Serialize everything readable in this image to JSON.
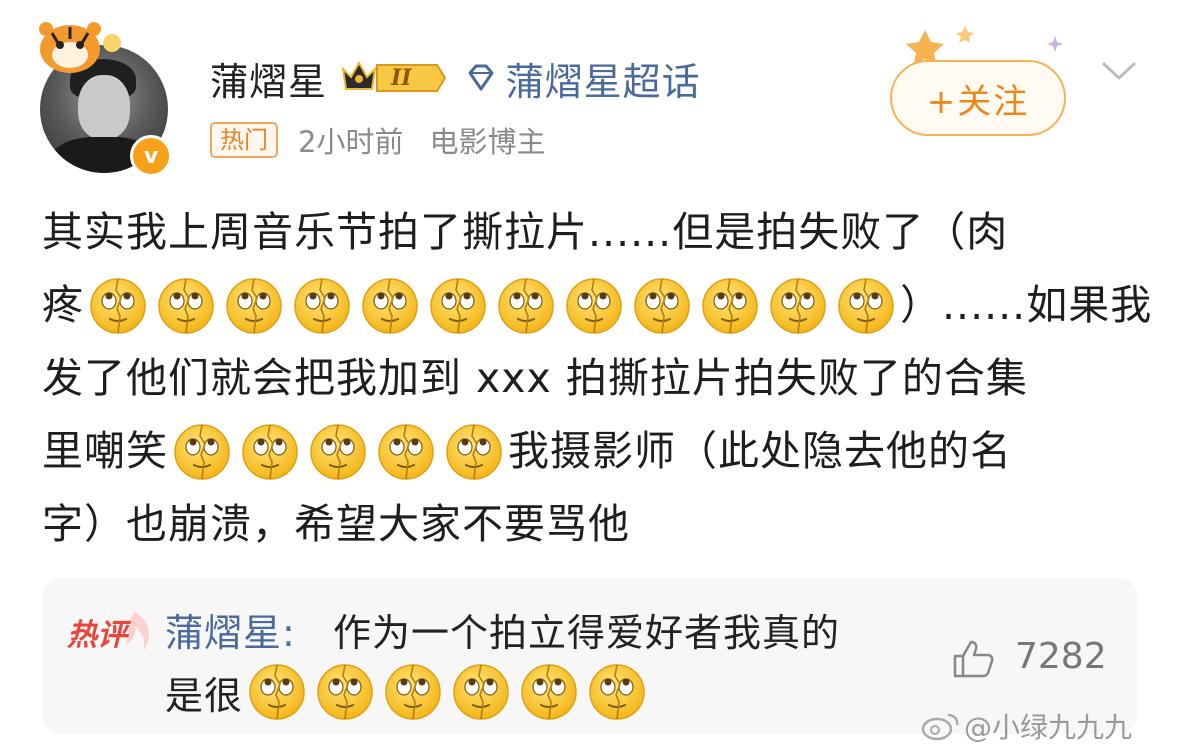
{
  "post": {
    "author": "蒲熠星",
    "vip_level": "II",
    "supertopic_label": "蒲熠星超话",
    "hot_tag": "热门",
    "time": "2小时前",
    "role": "电影博主",
    "follow_label": "+关注",
    "body": {
      "line1": "其实我上周音乐节拍了撕拉片......但是拍失败了（肉",
      "line2_prefix": "疼",
      "line2_suffix": "）......如果我",
      "line3": "发了他们就会把我加到 xxx 拍撕拉片拍失败了的合集",
      "line4_prefix": "里嘲笑",
      "line4_suffix": "我摄影师（此处隐去他的名",
      "line5": "字）也崩溃，希望大家不要骂他"
    },
    "emoji_name": "rolling-eyes-emoji"
  },
  "hot_comment": {
    "label": "热评",
    "author": "蒲熠星",
    "colon": ":",
    "line1": "作为一个拍立得爱好者我真的",
    "line2": "是很",
    "likes": "7282"
  },
  "watermark": {
    "text": "@小绿九九九"
  },
  "colors": {
    "accent_orange": "#f08619",
    "link_blue": "#4a6a9c",
    "hot_red": "#e8453c"
  }
}
